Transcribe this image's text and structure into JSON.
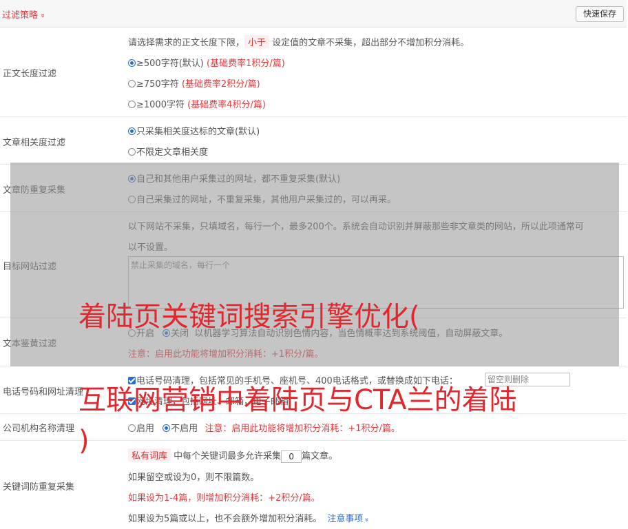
{
  "header": {
    "title": "过滤策略",
    "chevron": "»",
    "save_label": "快速保存"
  },
  "length_filter": {
    "label": "正文长度过滤",
    "desc_before": "请选择需求的正文长度下限，",
    "desc_tag": "小于",
    "desc_after": "设定值的文章不采集，超出部分不增加积分消耗。",
    "options": [
      {
        "label": "≥500字符(默认)",
        "note": "(基础费率1积分/篇)",
        "selected": true
      },
      {
        "label": "≥750字符",
        "note": "(基础费率2积分/篇)",
        "selected": false
      },
      {
        "label": "≥1000字符",
        "note": "(基础费率4积分/篇)",
        "selected": false
      }
    ]
  },
  "relevance_filter": {
    "label": "文章相关度过滤",
    "options": [
      {
        "label": "只采集相关度达标的文章(默认)",
        "selected": true
      },
      {
        "label": "不限定文章相关度",
        "selected": false
      }
    ]
  },
  "dedupe": {
    "label": "文章防重复采集",
    "options": [
      {
        "label": "自己和其他用户采集过的网址，都不重复采集(默认)",
        "selected": true
      },
      {
        "label": "自己采集过的网址，不重复采集，其他用户采集过的，可以再采。",
        "selected": false
      }
    ]
  },
  "site_filter": {
    "label": "目标网站过滤",
    "desc_line1": "以下网站不采集，只填域名，每行一个，最多200个。系统会自动识别并屏蔽那些非文章类的网站，所以此项通常可",
    "desc_line2": "以不设置。",
    "placeholder": "禁止采集的域名，每行一个"
  },
  "porn_filter": {
    "label": "文本鉴黄过滤",
    "opt_on": "开启",
    "opt_off": "关闭",
    "desc": "以机器学习算法自动识别色情内容，当色情概率达到系统阈值，自动屏蔽文章。",
    "note": "注意：启用此功能将增加积分消耗：+1积分/篇。"
  },
  "phone_filter": {
    "label": "电话号码和网址清理",
    "phone_desc": "电话号码清理，包括常见的手机号、座机号、400电话格式，或替换成如下电话：",
    "phone_placeholder": "留空则删除",
    "url_desc": "网址清理，包括网址、邮箱，电子邮箱"
  },
  "company_filter": {
    "label": "公司机构名称清理",
    "opt_on": "启用",
    "opt_off": "不启用",
    "note": "注意：启用此功能将增加积分消耗：+1积分/篇。"
  },
  "keyword_dedupe": {
    "label": "关键词防重复采集",
    "tag": "私有词库",
    "desc_before": "中每个关键词最多允许采集",
    "value": "0",
    "desc_after": "篇文章。",
    "line2": "如果留空或设为0，则不限篇数。",
    "line3": "如果设为1-4篇，则增加积分消耗：+2积分/篇。",
    "line4": "如果设为5篇或以上，也不会额外增加积分消耗。",
    "link": "注意事项",
    "link_chevron": "»"
  },
  "watermark": {
    "line1": "着陆页关键词搜索引擎优化(",
    "line2": "互联网营销中着陆页与CTA兰的着陆",
    "line3": ")"
  }
}
